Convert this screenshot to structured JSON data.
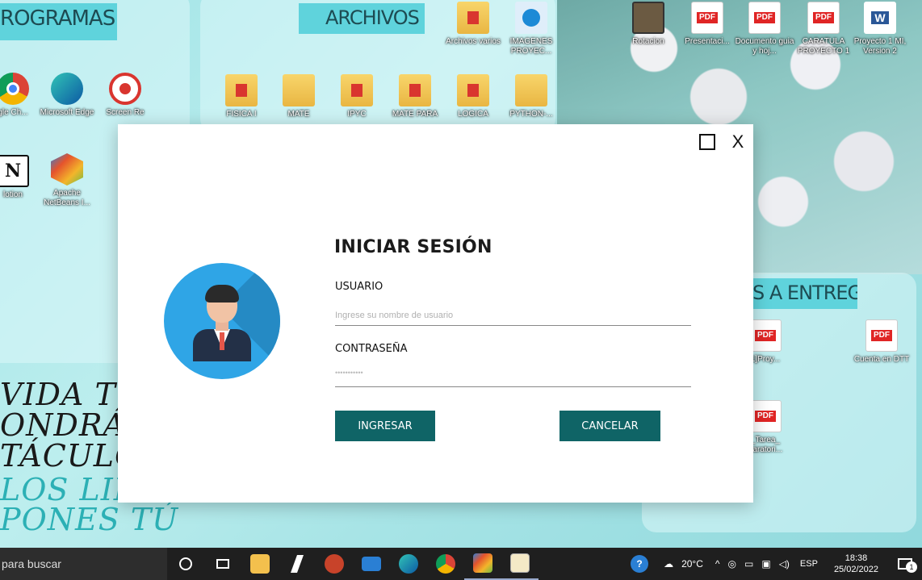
{
  "desktop": {
    "banners": {
      "programas": "ROGRAMAS",
      "archivos": "ARCHIVOS",
      "entregar": "S A ENTREGAR"
    },
    "icons": [
      {
        "label": "Archivos varios",
        "kind": "folder"
      },
      {
        "label": "IMAGENES PROYEC...",
        "kind": "edge"
      },
      {
        "label": "Rotacion",
        "kind": "video"
      },
      {
        "label": "Presentaci...",
        "kind": "pdf"
      },
      {
        "label": "Documento guia y hoj...",
        "kind": "pdf"
      },
      {
        "label": "CARATULA PROYECTO 1",
        "kind": "pdf"
      },
      {
        "label": "Proyecto 1 MI, Version 2",
        "kind": "word"
      },
      {
        "label": "gle Ch...",
        "kind": "chrome"
      },
      {
        "label": "Microsoft Edge",
        "kind": "edge"
      },
      {
        "label": "Screen Re",
        "kind": "record"
      },
      {
        "label": "FISICA I",
        "kind": "folder"
      },
      {
        "label": "MATE",
        "kind": "folder"
      },
      {
        "label": "IPYC",
        "kind": "folder"
      },
      {
        "label": "MATE PARA",
        "kind": "folder"
      },
      {
        "label": "LOGICA",
        "kind": "folder"
      },
      {
        "label": "PYTHON-...",
        "kind": "folder"
      },
      {
        "label": "lotion",
        "kind": "notion"
      },
      {
        "label": "Apache NetBeans I...",
        "kind": "netbeans"
      },
      {
        "label": "1]Proy...",
        "kind": "pdf"
      },
      {
        "label": "Cuenta en DTT",
        "kind": "pdf"
      },
      {
        "label": "_Tarea_ paratori...",
        "kind": "pdf"
      }
    ],
    "quote": [
      "VIDA T",
      "ONDRÁ",
      "TÁCULO",
      "LOS LIM",
      "PONES TÚ"
    ],
    "pdf_badge": "PDF"
  },
  "dialog": {
    "maximize_symbol": "☐",
    "close_label": "X",
    "title": "INICIAR SESIÓN",
    "usuario_label": "USUARIO",
    "usuario_placeholder": "Ingrese su nombre de usuario",
    "password_label": "CONTRASEÑA",
    "password_value": "•••••••••••",
    "ingresar_label": "INGRESAR",
    "cancelar_label": "CANCELAR"
  },
  "taskbar": {
    "search_text": "para buscar",
    "weather": "20°C",
    "language": "ESP",
    "time": "18:38",
    "date": "25/02/2022",
    "notification_count": "1"
  },
  "colors": {
    "accent": "#0f6466",
    "avatar_bg": "#2fa5e6",
    "banner": "#5fd3dc"
  }
}
